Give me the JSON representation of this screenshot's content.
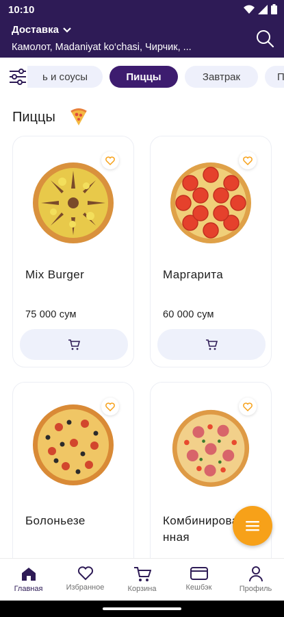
{
  "status_bar": {
    "time": "10:10"
  },
  "header": {
    "delivery_label": "Доставка",
    "address": "Камолот, Madaniyat ko‘chasi, Чирчик, ..."
  },
  "categories": [
    {
      "label": "ь и соусы",
      "active": false
    },
    {
      "label": "Пиццы",
      "active": true
    },
    {
      "label": "Завтрак",
      "active": false
    },
    {
      "label": "П",
      "active": false
    }
  ],
  "section": {
    "title": "Пиццы"
  },
  "products": [
    {
      "name": "Mix Burger",
      "price": "75 000 сум"
    },
    {
      "name": "Маргарита",
      "price": "60 000 сум"
    },
    {
      "name": "Болоньезе",
      "price": ""
    },
    {
      "name": "Комбинированная",
      "price": ""
    }
  ],
  "bottom_nav": [
    {
      "label": "Главная",
      "icon": "home-icon",
      "active": true
    },
    {
      "label": "Избранное",
      "icon": "heart-icon",
      "active": false
    },
    {
      "label": "Корзина",
      "icon": "cart-icon",
      "active": false
    },
    {
      "label": "Кешбэк",
      "icon": "card-icon",
      "active": false
    },
    {
      "label": "Профиль",
      "icon": "user-icon",
      "active": false
    }
  ],
  "colors": {
    "brand": "#2e1b56",
    "accent": "#f7a119",
    "chip_bg": "#eef0fb"
  }
}
